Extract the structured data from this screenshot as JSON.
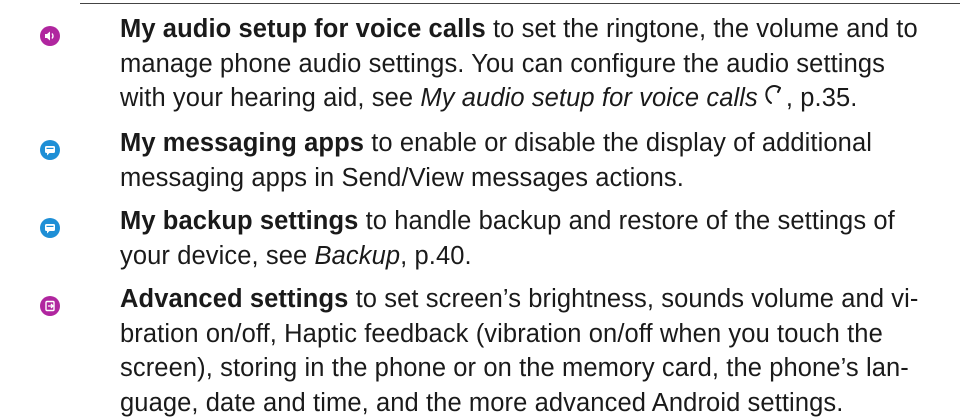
{
  "colors": {
    "audio_bullet": "#b0269f",
    "messaging_bullet": "#1e8fd6",
    "backup_bullet": "#1e8fd6",
    "advanced_bullet": "#b0269f"
  },
  "items": [
    {
      "icon": "speaker-icon",
      "term": "My audio setup for voice calls",
      "lines": [
        " to set the ringtone, the volume and to",
        "manage phone audio settings. You can configure the audio settings"
      ],
      "last_prefix": "with your hearing aid, see ",
      "ref": "My audio setup for voice calls",
      "last_suffix": ", p.35."
    },
    {
      "icon": "chat-bubble-icon",
      "term": "My messaging apps",
      "lines": [
        " to enable or disable the display of additional",
        "messaging apps in Send/View messages actions."
      ]
    },
    {
      "icon": "chat-bubble-icon",
      "term": "My backup settings",
      "lines": [
        " to handle backup and restore of the settings of"
      ],
      "last_prefix": "your device, see ",
      "ref": "Backup",
      "last_suffix": ", p.40."
    },
    {
      "icon": "settings-exit-icon",
      "term": "Advanced settings",
      "lines": [
        " to set screen’s brightness, sounds volume and vi-",
        "bration on/off, Haptic feedback (vibration on/off when you touch the",
        "screen), storing in the phone or on the memory card, the phone’s lan-",
        "guage, date and time, and the more advanced Android settings."
      ]
    }
  ]
}
